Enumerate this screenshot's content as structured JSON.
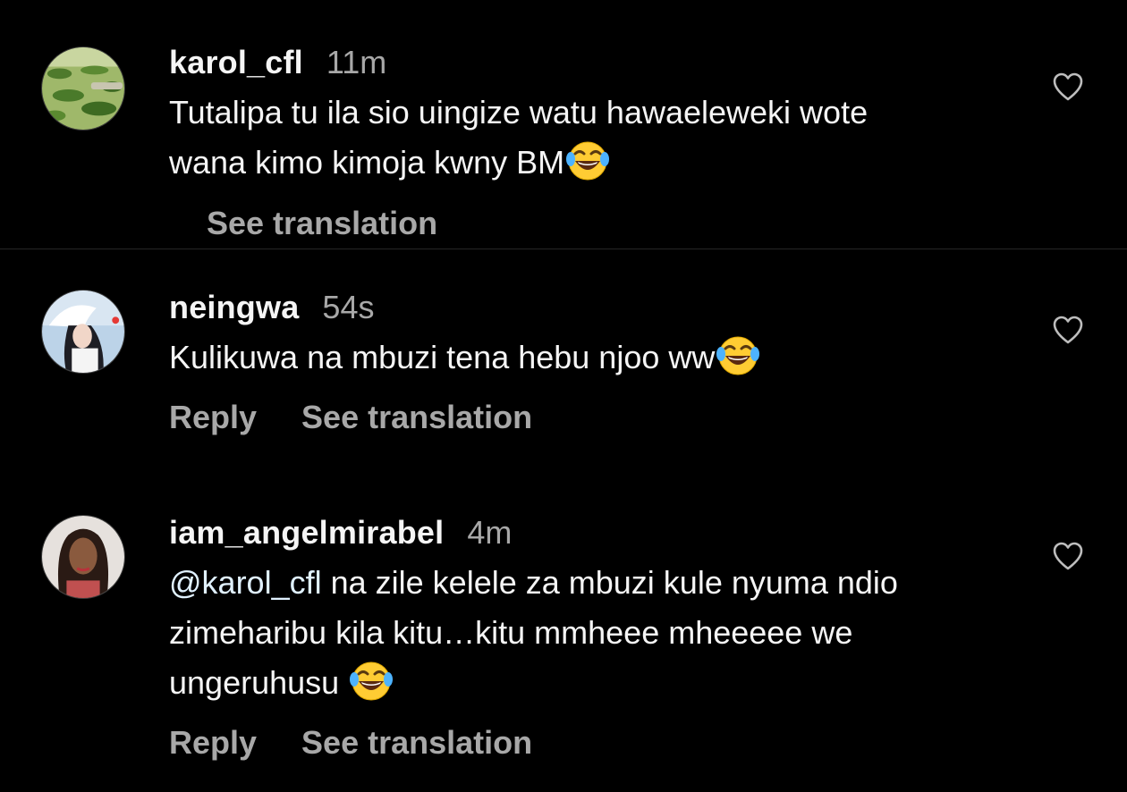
{
  "colors": {
    "background": "#000000",
    "text_primary": "#f5f5f5",
    "text_secondary": "#a8a8a8",
    "divider": "#262626"
  },
  "comments": [
    {
      "username": "karol_cfl",
      "time": "11m",
      "text_line1": "Tutalipa tu ila sio uingize watu hawaeleweki wote",
      "text_line2": "wana kimo kimoja kwny BM",
      "emoji": "face-with-tears-of-joy",
      "see_translation": "See translation",
      "like_icon": "heart-outline-icon"
    },
    {
      "username": "neingwa",
      "time": "54s",
      "text_line1": "Kulikuwa na mbuzi tena hebu njoo ww",
      "emoji": "face-with-tears-of-joy",
      "reply": "Reply",
      "see_translation": "See translation",
      "like_icon": "heart-outline-icon"
    },
    {
      "username": "iam_angelmirabel",
      "time": "4m",
      "mention": "@karol_cfl",
      "text_line1": " na zile kelele za mbuzi kule nyuma ndio",
      "text_line2": "zimeharibu kila kitu…kitu mmheee mheeeee we",
      "text_line3": "ungeruhusu ",
      "emoji": "face-with-tears-of-joy",
      "reply": "Reply",
      "see_translation": "See translation",
      "like_icon": "heart-outline-icon"
    }
  ]
}
